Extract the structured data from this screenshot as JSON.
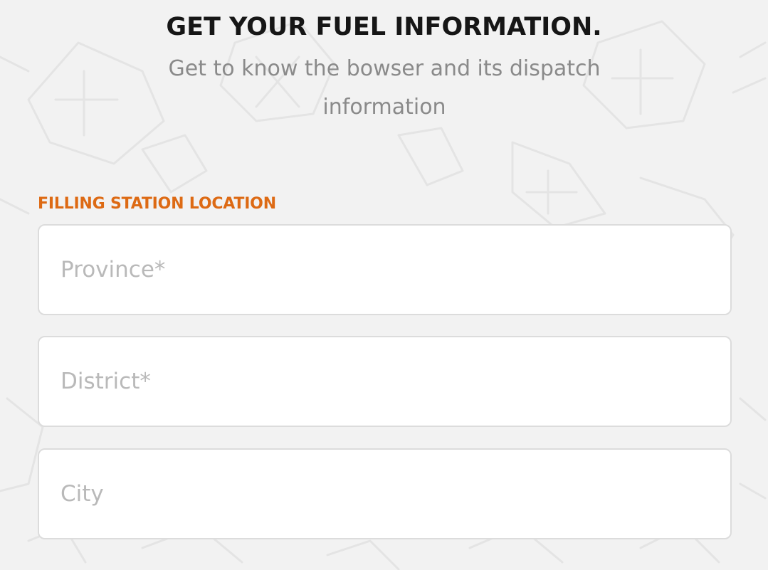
{
  "header": {
    "title": "GET YOUR FUEL INFORMATION.",
    "subtitle": "Get to know the bowser and its dispatch information"
  },
  "form": {
    "section_label": "FILLING STATION LOCATION",
    "fields": [
      {
        "name": "province",
        "value": "",
        "placeholder": "Province*"
      },
      {
        "name": "district",
        "value": "",
        "placeholder": "District*"
      },
      {
        "name": "city",
        "value": "",
        "placeholder": "City"
      }
    ]
  },
  "colors": {
    "background": "#f2f2f2",
    "title": "#161616",
    "subtitle": "#8a8a8a",
    "accent": "#dd6a14",
    "field_border": "#dcdcdc",
    "placeholder": "#b9b9b9"
  },
  "icons": [
    "fuel-can-pattern-icon",
    "fuel-nozzle-pattern-icon"
  ]
}
